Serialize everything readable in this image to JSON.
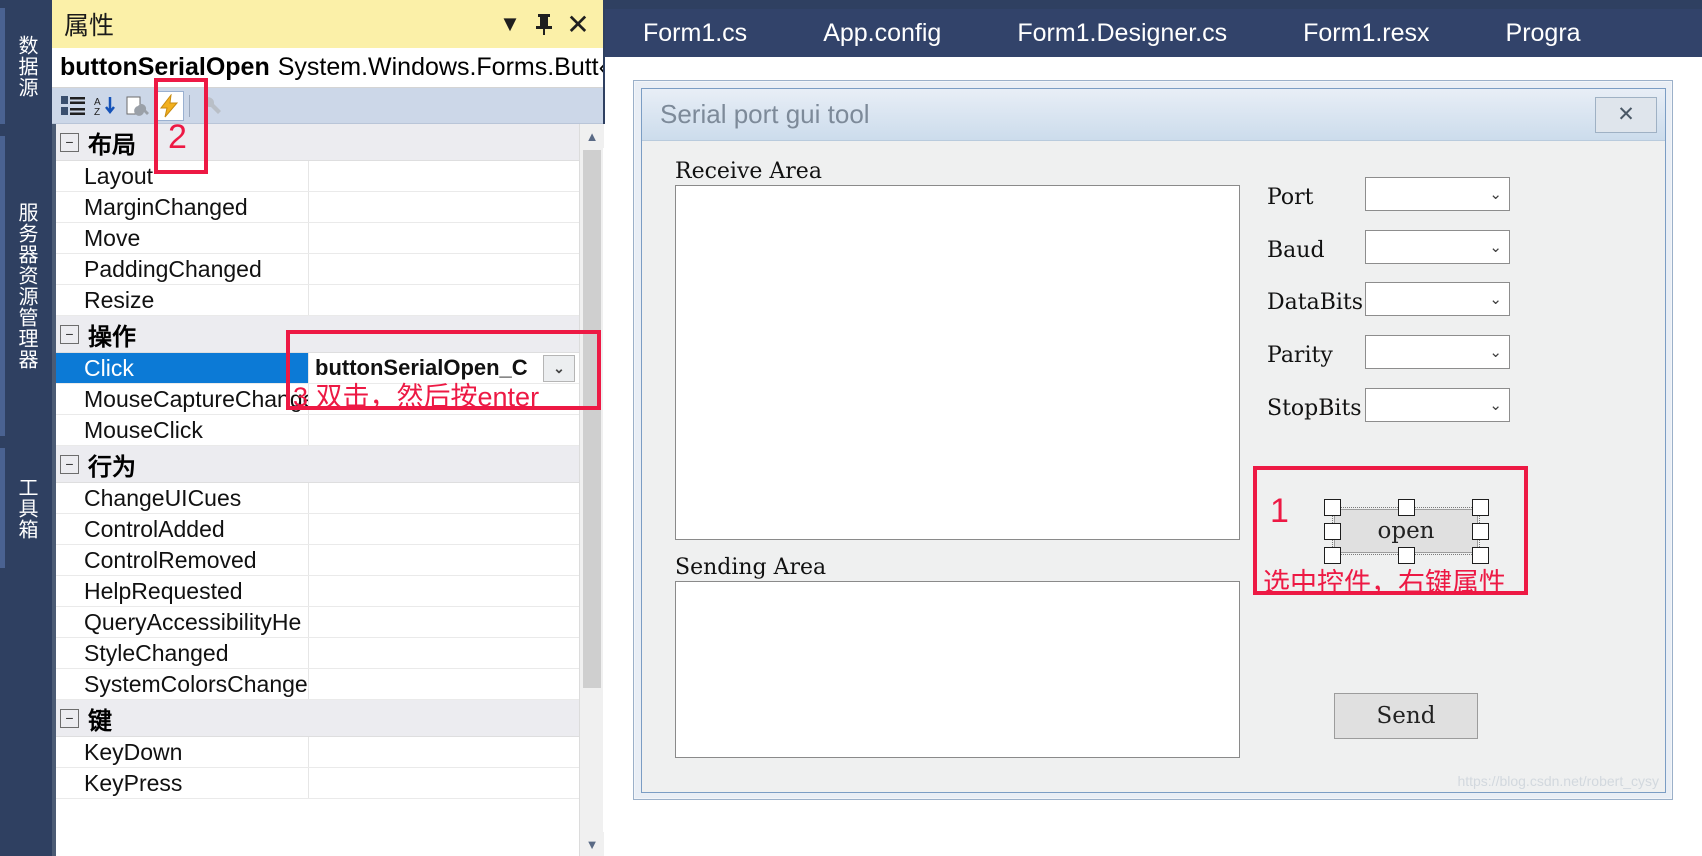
{
  "dock": {
    "tabs": [
      {
        "label": "数据源"
      },
      {
        "label": "服务器资源管理器"
      },
      {
        "label": "工具箱"
      }
    ]
  },
  "properties_panel": {
    "title": "属性",
    "titlebar_buttons": [
      {
        "name": "dropdown",
        "glyph": "▼"
      },
      {
        "name": "pin",
        "glyph": "⇱"
      },
      {
        "name": "close",
        "glyph": "✕"
      }
    ],
    "object_name": "buttonSerialOpen",
    "object_type": "System.Windows.Forms.Butt‹",
    "object_caret": "▾",
    "toolbar": [
      {
        "name": "categorized",
        "glyph": "▤"
      },
      {
        "name": "alphabetical",
        "glyph": "A↓"
      },
      {
        "name": "properties",
        "glyph": "🔧"
      },
      {
        "name": "events",
        "glyph": "⚡"
      },
      {
        "name": "property-pages",
        "glyph": "🔧"
      }
    ],
    "groups": [
      {
        "label": "布局",
        "rows": [
          {
            "name": "Layout",
            "value": ""
          },
          {
            "name": "MarginChanged",
            "value": ""
          },
          {
            "name": "Move",
            "value": ""
          },
          {
            "name": "PaddingChanged",
            "value": ""
          },
          {
            "name": "Resize",
            "value": ""
          }
        ]
      },
      {
        "label": "操作",
        "rows": [
          {
            "name": "Click",
            "value": "buttonSerialOpen_C",
            "selected": true,
            "dropdown": "⌄"
          },
          {
            "name": "MouseCaptureChanged",
            "value": ""
          },
          {
            "name": "MouseClick",
            "value": ""
          }
        ]
      },
      {
        "label": "行为",
        "rows": [
          {
            "name": "ChangeUICues",
            "value": ""
          },
          {
            "name": "ControlAdded",
            "value": ""
          },
          {
            "name": "ControlRemoved",
            "value": ""
          },
          {
            "name": "HelpRequested",
            "value": ""
          },
          {
            "name": "QueryAccessibilityHe",
            "value": ""
          },
          {
            "name": "StyleChanged",
            "value": ""
          },
          {
            "name": "SystemColorsChange",
            "value": ""
          }
        ]
      },
      {
        "label": "键",
        "rows": [
          {
            "name": "KeyDown",
            "value": ""
          },
          {
            "name": "KeyPress",
            "value": ""
          }
        ]
      }
    ],
    "scrollbar": {
      "up": "▲",
      "down": "▼"
    }
  },
  "editor": {
    "tabs": [
      {
        "label": "Form1.cs"
      },
      {
        "label": "App.config"
      },
      {
        "label": "Form1.Designer.cs"
      },
      {
        "label": "Form1.resx"
      },
      {
        "label": "Progra"
      }
    ]
  },
  "form": {
    "title": "Serial port gui tool",
    "close_glyph": "✕",
    "receive_label": "Receive Area",
    "sending_label": "Sending Area",
    "fields": [
      {
        "label": "Port"
      },
      {
        "label": "Baud"
      },
      {
        "label": "DataBits"
      },
      {
        "label": "Parity"
      },
      {
        "label": "StopBits"
      }
    ],
    "combo_chevron": "⌄",
    "open_button": "open",
    "send_button": "Send"
  },
  "annotations": {
    "step1_num": "1",
    "step1_text": "选中控件，右键属性",
    "step2_num": "2",
    "step3_text": "3 双击，然后按enter",
    "color": "#ed1944"
  },
  "watermark": "https://blog.csdn.net/robert_cysy"
}
